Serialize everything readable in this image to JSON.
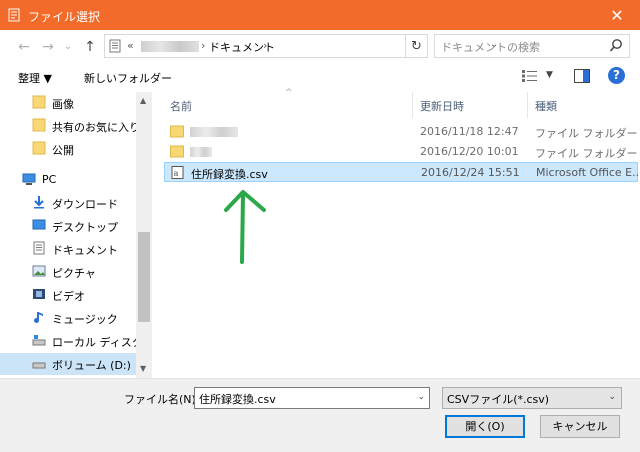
{
  "window": {
    "title": "ファイル選択",
    "close_glyph": "✕"
  },
  "nav": {
    "back": "←",
    "forward": "→",
    "recent": "⌄",
    "up": "↑",
    "address_prefix": "«",
    "path_sep": "›",
    "path": "ドキュメント",
    "address_dropdown": "⌄",
    "refresh": "↻",
    "search_placeholder": "ドキュメントの検索"
  },
  "toolbar": {
    "organize": "整理 ▼",
    "new_folder": "新しいフォルダー",
    "view_dropdown": "▼",
    "help": "?"
  },
  "sidebar": {
    "items": [
      {
        "label": "画像",
        "icon": "folder-icon"
      },
      {
        "label": "共有のお気に入り",
        "icon": "folder-icon"
      },
      {
        "label": "公開",
        "icon": "folder-icon"
      },
      {
        "label": "PC",
        "icon": "pc-icon"
      },
      {
        "label": "ダウンロード",
        "icon": "download-icon"
      },
      {
        "label": "デスクトップ",
        "icon": "desktop-icon"
      },
      {
        "label": "ドキュメント",
        "icon": "document-icon"
      },
      {
        "label": "ピクチャ",
        "icon": "pictures-icon"
      },
      {
        "label": "ビデオ",
        "icon": "video-icon"
      },
      {
        "label": "ミュージック",
        "icon": "music-icon"
      },
      {
        "label": "ローカル ディスク (C",
        "icon": "disk-icon"
      },
      {
        "label": "ボリューム (D:)",
        "icon": "volume-icon"
      }
    ],
    "selected_index": 11,
    "scroll_up": "▲",
    "scroll_down": "▼"
  },
  "file_list": {
    "columns": {
      "name": "名前",
      "date": "更新日時",
      "type": "種類",
      "sort_indicator": "^"
    },
    "rows": [
      {
        "name": "",
        "date": "2016/11/18 12:47",
        "type": "ファイル フォルダー",
        "kind": "folder"
      },
      {
        "name": "",
        "date": "2016/12/20 10:01",
        "type": "ファイル フォルダー",
        "kind": "folder"
      },
      {
        "name": "住所録変換.csv",
        "date": "2016/12/24 15:51",
        "type": "Microsoft Office E...",
        "kind": "csv"
      }
    ],
    "selected_index": 2
  },
  "bottom": {
    "filename_label": "ファイル名(N):",
    "filename_value": "住所録変換.csv",
    "filter_value": "CSVファイル(*.csv)",
    "dropdown_glyph": "⌄",
    "open_button": "開く(O)",
    "cancel_button": "キャンセル"
  },
  "colors": {
    "titlebar": "#f26b2a",
    "selection": "#cce8ff",
    "annotation_arrow": "#2aa84a",
    "help": "#2a6fd6"
  }
}
